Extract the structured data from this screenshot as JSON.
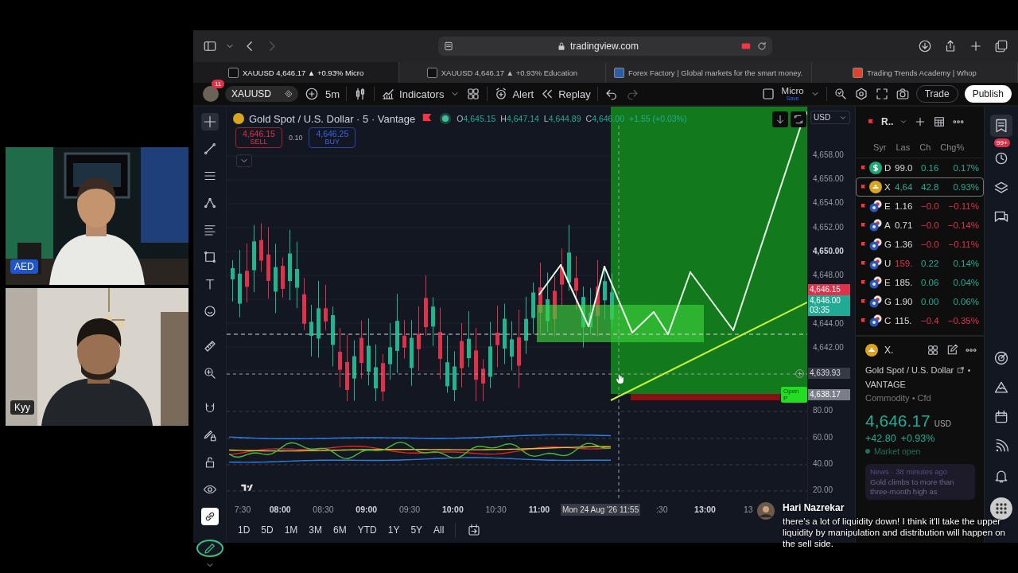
{
  "participants": [
    {
      "label": "AED",
      "kind": "picture"
    },
    {
      "label": "Kyy",
      "kind": "picture"
    }
  ],
  "browser": {
    "address": "tradingview.com",
    "tabs": [
      {
        "title": "XAUUSD 4,646.17 ▲ +0.93% Micro",
        "selected": true
      },
      {
        "title": "XAUUSD 4,646.17 ▲ +0.93% Education",
        "selected": false
      },
      {
        "title": "Forex Factory | Global markets for the smart money.",
        "selected": false
      },
      {
        "title": "Trading Trends Academy | Whop",
        "selected": false
      }
    ]
  },
  "toolbar": {
    "notification_count": "11",
    "symbol": "XAUUSD",
    "interval": "5m",
    "indicators": "Indicators",
    "alert": "Alert",
    "replay": "Replay",
    "layout": "Micro",
    "layout_status": "Save",
    "trade": "Trade",
    "publish": "Publish"
  },
  "chart": {
    "title": "Gold Spot / U.S. Dollar · 5 · Vantage",
    "ohlc": [
      {
        "label": "O",
        "value": "4,645.15"
      },
      {
        "label": "H",
        "value": "4,647.14"
      },
      {
        "label": "L",
        "value": "4,644.89"
      },
      {
        "label": "C",
        "value": "4,646.00"
      }
    ],
    "change": "+1.55 (+0.03%)",
    "sell": {
      "price": "4,646.15",
      "label": "SELL"
    },
    "spread": "0.10",
    "buy": {
      "price": "4,646.25",
      "label": "BUY"
    },
    "position_label": "Open P",
    "price_axis": {
      "currency": "USD",
      "ticks": [
        {
          "text": "4,658.00",
          "major": false
        },
        {
          "text": "4,656.00",
          "major": false
        },
        {
          "text": "4,654.00",
          "major": false
        },
        {
          "text": "4,652.00",
          "major": false
        },
        {
          "text": "4,650.00",
          "major": true
        },
        {
          "text": "4,648.00",
          "major": false
        },
        {
          "text": "4,644.00",
          "major": false
        },
        {
          "text": "4,642.00",
          "major": false
        }
      ],
      "tags": [
        {
          "value": "4,646.15",
          "kind": "bid"
        },
        {
          "value": "4,646.00",
          "time": "03:35",
          "kind": "last"
        },
        {
          "value": "4,639.93",
          "kind": "crosshair"
        },
        {
          "value": "4,638.17",
          "kind": "position"
        }
      ],
      "indicator_ticks": [
        "80.00",
        "60.00",
        "40.00",
        "20.00"
      ]
    },
    "time_axis": [
      {
        "text": "7:30",
        "kind": "tick",
        "major": false
      },
      {
        "text": "08:00",
        "kind": "tick",
        "major": true
      },
      {
        "text": "08:30",
        "kind": "tick",
        "major": false
      },
      {
        "text": "09:00",
        "kind": "tick",
        "major": true
      },
      {
        "text": "09:30",
        "kind": "tick",
        "major": false
      },
      {
        "text": "10:00",
        "kind": "tick",
        "major": true
      },
      {
        "text": "10:30",
        "kind": "tick",
        "major": false
      },
      {
        "text": "11:00",
        "kind": "tick",
        "major": true
      },
      {
        "text": "Mon 24 Aug '26  11:55",
        "kind": "crosshair",
        "major": false
      },
      {
        "text": ":30",
        "kind": "tick",
        "major": false
      },
      {
        "text": "13:00",
        "kind": "tick",
        "major": true
      },
      {
        "text": "13",
        "kind": "tick",
        "major": false
      }
    ],
    "ranges": [
      "1D",
      "5D",
      "1M",
      "3M",
      "6M",
      "YTD",
      "1Y",
      "5Y",
      "All"
    ]
  },
  "watchlist": {
    "name": "R..",
    "badge": "99+",
    "columns": [
      "Syr",
      "Las",
      "Ch",
      "Chg%"
    ],
    "rows": [
      {
        "symbol": "D",
        "last": "99.0",
        "change": "0.16",
        "change_pct": "0.17%",
        "last_up": false,
        "last_down": false,
        "color": "#22ab94",
        "kind": "dollar",
        "selected": false
      },
      {
        "symbol": "X",
        "last": "4,64",
        "change": "42.8",
        "change_pct": "0.93%",
        "last_up": true,
        "last_down": false,
        "color": "#22ab94",
        "kind": "gold",
        "selected": true
      },
      {
        "symbol": "E",
        "last": "1.16",
        "change": "−0.0",
        "change_pct": "−0.11%",
        "last_up": false,
        "last_down": false,
        "color": "#e0314b",
        "kind": "pair",
        "selected": false
      },
      {
        "symbol": "A",
        "last": "0.71",
        "change": "−0.0",
        "change_pct": "−0.14%",
        "last_up": false,
        "last_down": false,
        "color": "#e0314b",
        "kind": "pair",
        "selected": false
      },
      {
        "symbol": "G",
        "last": "1.36",
        "change": "−0.0",
        "change_pct": "−0.11%",
        "last_up": false,
        "last_down": false,
        "color": "#e0314b",
        "kind": "pair",
        "selected": false
      },
      {
        "symbol": "U",
        "last": "159.",
        "change": "0.22",
        "change_pct": "0.14%",
        "last_up": false,
        "last_down": true,
        "color": "#22ab94",
        "kind": "pair",
        "selected": false
      },
      {
        "symbol": "E",
        "last": "185.",
        "change": "0.06",
        "change_pct": "0.04%",
        "last_up": false,
        "last_down": false,
        "color": "#22ab94",
        "kind": "pair",
        "selected": false
      },
      {
        "symbol": "G",
        "last": "1.90",
        "change": "0.00",
        "change_pct": "0.06%",
        "last_up": false,
        "last_down": false,
        "color": "#22ab94",
        "kind": "pair",
        "selected": false
      },
      {
        "symbol": "C",
        "last": "115.",
        "change": "−0.4",
        "change_pct": "−0.35%",
        "last_up": false,
        "last_down": false,
        "color": "#e0314b",
        "kind": "pair",
        "selected": false
      }
    ]
  },
  "details": {
    "symbol": "X.",
    "name": "Gold Spot / U.S. Dollar",
    "exchange": "VANTAGE",
    "category": "Commodity • Cfd",
    "price": "4,646.17",
    "currency": "USD",
    "change": "+42.80",
    "change_pct": "+0.93%",
    "status": "Market open",
    "news": {
      "meta": "News · 38 minutes ago",
      "headline": "Gold climbs to more than three-month high as"
    }
  },
  "comment": {
    "author": "Hari Nazrekar",
    "text": "there's a lot of liquidity down! I think it'll take the upper liquidity by manipulation and distribution will happen on the sell side."
  }
}
